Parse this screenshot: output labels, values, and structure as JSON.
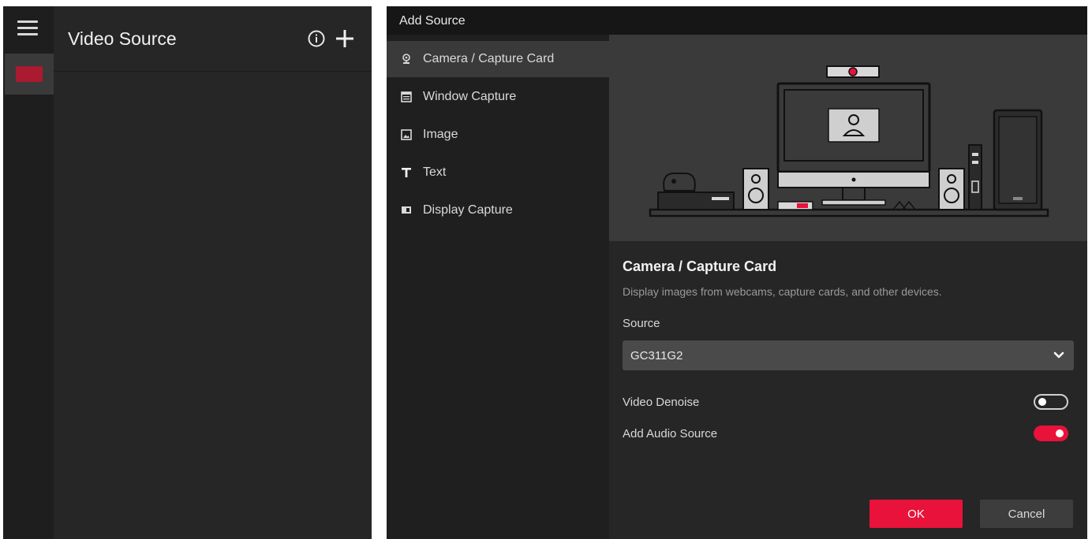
{
  "left_panel": {
    "title": "Video Source"
  },
  "dialog": {
    "title": "Add Source",
    "sources": [
      {
        "label": "Camera / Capture Card",
        "icon": "webcam-icon",
        "active": true
      },
      {
        "label": "Window Capture",
        "icon": "window-icon",
        "active": false
      },
      {
        "label": "Image",
        "icon": "image-icon",
        "active": false
      },
      {
        "label": "Text",
        "icon": "text-icon",
        "active": false
      },
      {
        "label": "Display Capture",
        "icon": "monitor-icon",
        "active": false
      }
    ],
    "detail": {
      "title": "Camera / Capture Card",
      "description": "Display images from webcams, capture cards, and other devices.",
      "source_label": "Source",
      "source_value": "GC311G2",
      "video_denoise_label": "Video Denoise",
      "video_denoise_on": false,
      "add_audio_label": "Add Audio Source",
      "add_audio_on": true
    },
    "buttons": {
      "ok": "OK",
      "cancel": "Cancel"
    }
  },
  "colors": {
    "accent": "#e8123a",
    "panel": "#262626",
    "sidebar": "#1f1f1f",
    "titlebar": "#161616"
  }
}
